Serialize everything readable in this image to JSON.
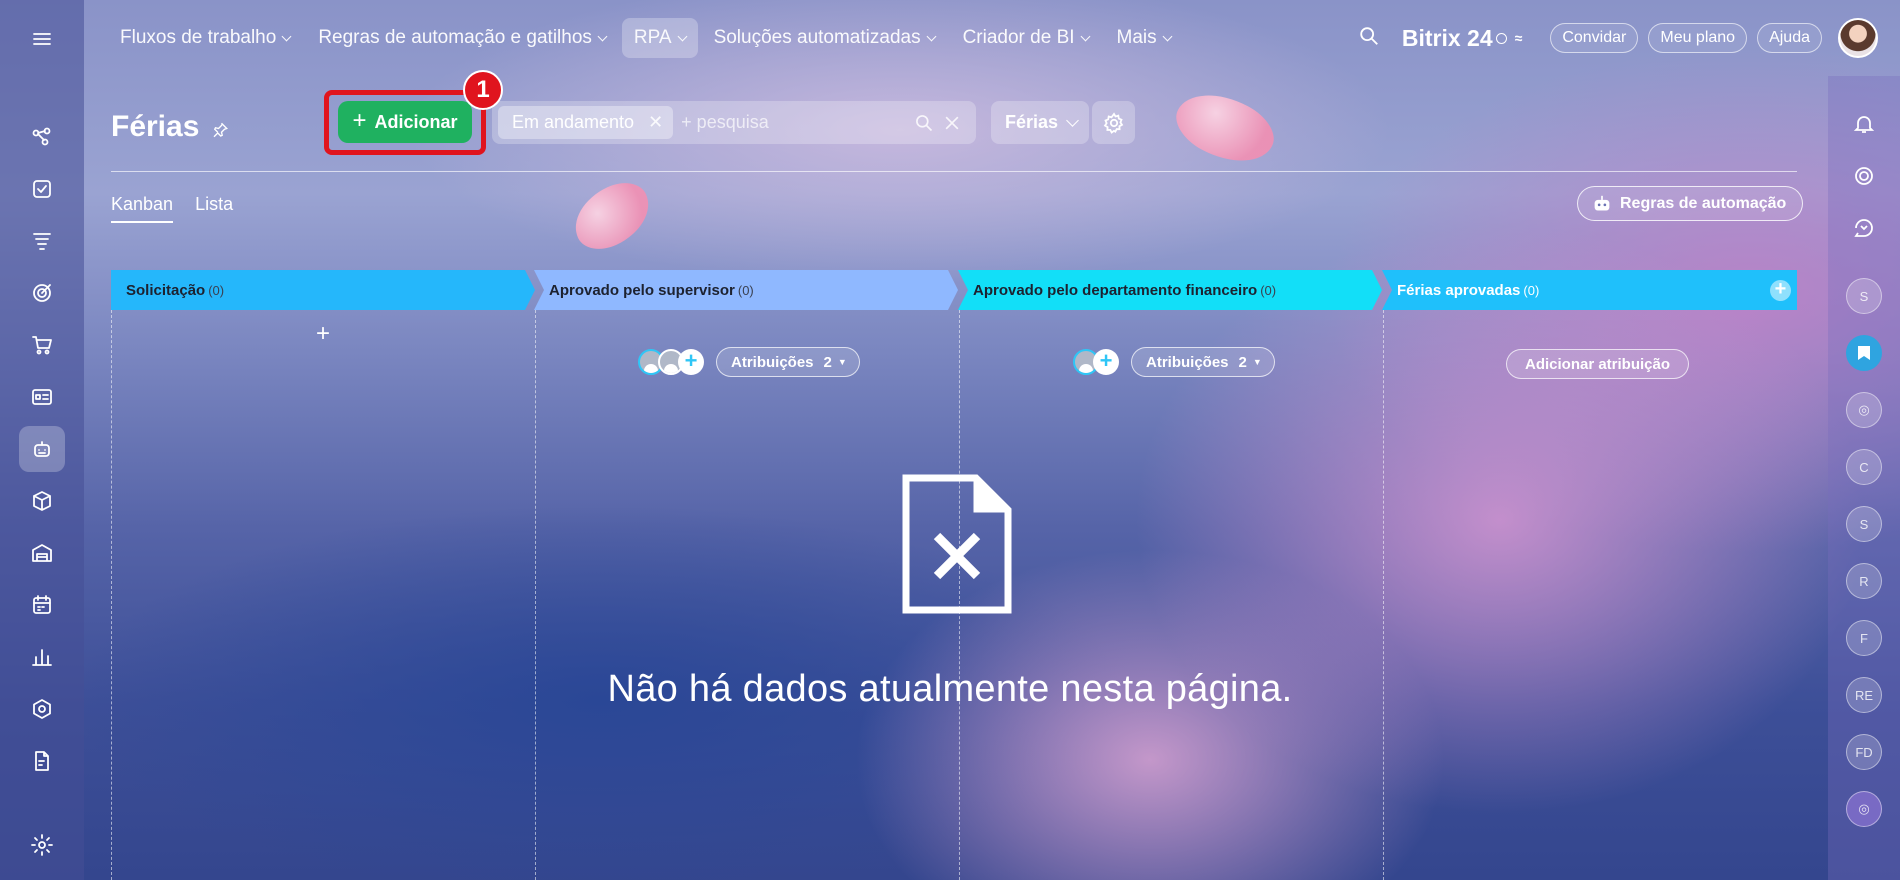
{
  "topbar": {
    "nav": [
      {
        "label": "Fluxos de trabalho"
      },
      {
        "label": "Regras de automação e gatilhos"
      },
      {
        "label": "RPA"
      },
      {
        "label": "Soluções automatizadas"
      },
      {
        "label": "Criador de BI"
      },
      {
        "label": "Mais"
      }
    ],
    "active_nav": "RPA",
    "brand": "Bitrix 24",
    "invite_label": "Convidar",
    "plan_label": "Meu plano",
    "help_label": "Ajuda"
  },
  "page": {
    "title": "Férias",
    "add_label": "Adicionar",
    "step_number": "1",
    "filter_tag": "Em andamento",
    "search_placeholder": "+ pesquisa",
    "preset_label": "Férias",
    "automation_rules_label": "Regras de automação"
  },
  "view_tabs": [
    {
      "label": "Kanban",
      "active": true
    },
    {
      "label": "Lista",
      "active": false
    }
  ],
  "stages": [
    {
      "name": "Solicitação",
      "count": "(0)",
      "color": "#25b7fb"
    },
    {
      "name": "Aprovado pelo supervisor",
      "count": "(0)",
      "color": "#8fb8ff"
    },
    {
      "name": "Aprovado pelo departamento financeiro",
      "count": "(0)",
      "color": "#12dff8"
    },
    {
      "name": "Férias aprovadas",
      "count": "(0)",
      "color": "#1fc0fb"
    }
  ],
  "assignments": {
    "label": "Atribuições",
    "supervisor_count": "2",
    "finance_count": "2",
    "add_label": "Adicionar atribuição"
  },
  "empty_state": {
    "text": "Não há dados atualmente nesta página."
  },
  "right_rail": {
    "avatars": [
      "S",
      "",
      "",
      "C",
      "S",
      "R",
      "F",
      "RE",
      "FD",
      ""
    ]
  },
  "colors": {
    "add_button": "#1fb160",
    "highlight": "#e0141e"
  }
}
